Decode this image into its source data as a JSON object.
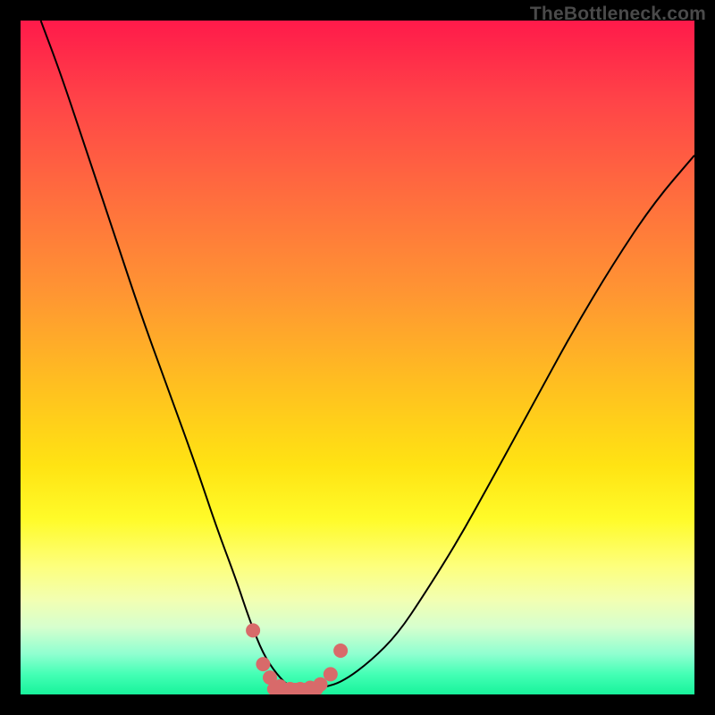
{
  "watermark": "TheBottleneck.com",
  "colors": {
    "frame_bg": "#000000",
    "watermark_text": "#4a4a4a",
    "curve_stroke": "#000000",
    "marker_fill": "#d86a6a",
    "gradient_top": "#ff1a4a",
    "gradient_bottom": "#18f39b"
  },
  "chart_data": {
    "type": "line",
    "title": "",
    "xlabel": "",
    "ylabel": "",
    "xlim": [
      0,
      100
    ],
    "ylim": [
      0,
      100
    ],
    "series": [
      {
        "name": "bottleneck-curve",
        "x": [
          3,
          6,
          10,
          14,
          18,
          22,
          26,
          29,
          32,
          34,
          36,
          38,
          40,
          42,
          45,
          48,
          52,
          56,
          60,
          65,
          70,
          76,
          82,
          88,
          94,
          100
        ],
        "y": [
          100,
          92,
          80,
          68,
          56,
          45,
          34,
          25,
          17,
          11,
          6,
          3,
          1,
          1,
          1,
          2,
          5,
          9,
          15,
          23,
          32,
          43,
          54,
          64,
          73,
          80
        ]
      }
    ],
    "markers": {
      "name": "highlighted-points",
      "x": [
        34.5,
        36.0,
        37.0,
        38.5,
        40.0,
        41.5,
        43.0,
        44.5,
        46.0,
        47.5
      ],
      "y": [
        9.5,
        4.5,
        2.5,
        1.2,
        0.8,
        0.8,
        1.0,
        1.5,
        3.0,
        6.5
      ]
    },
    "flat_band": {
      "x0": 37.5,
      "x1": 44.0,
      "y": 0.8
    }
  }
}
